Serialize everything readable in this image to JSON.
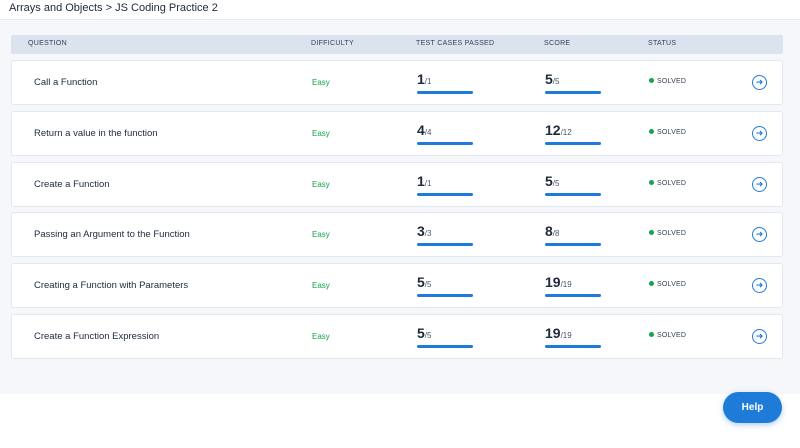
{
  "breadcrumb": {
    "parent": "Arrays and Objects",
    "separator": ">",
    "current": "JS Coding Practice 2"
  },
  "table": {
    "headers": {
      "question": "QUESTION",
      "difficulty": "DIFFICULTY",
      "tests": "TEST CASES PASSED",
      "score": "SCORE",
      "status": "STATUS"
    },
    "rows": [
      {
        "question": "Call a Function",
        "difficulty": "Easy",
        "tests_passed": "1",
        "tests_total": "/1",
        "tests_fraction": 1,
        "score": "5",
        "score_total": "/5",
        "score_fraction": 1,
        "status": "SOLVED"
      },
      {
        "question": "Return a value in the function",
        "difficulty": "Easy",
        "tests_passed": "4",
        "tests_total": "/4",
        "tests_fraction": 1,
        "score": "12",
        "score_total": "/12",
        "score_fraction": 1,
        "status": "SOLVED"
      },
      {
        "question": "Create a Function",
        "difficulty": "Easy",
        "tests_passed": "1",
        "tests_total": "/1",
        "tests_fraction": 1,
        "score": "5",
        "score_total": "/5",
        "score_fraction": 1,
        "status": "SOLVED"
      },
      {
        "question": "Passing an Argument to the Function",
        "difficulty": "Easy",
        "tests_passed": "3",
        "tests_total": "/3",
        "tests_fraction": 1,
        "score": "8",
        "score_total": "/8",
        "score_fraction": 1,
        "status": "SOLVED"
      },
      {
        "question": "Creating a Function with Parameters",
        "difficulty": "Easy",
        "tests_passed": "5",
        "tests_total": "/5",
        "tests_fraction": 1,
        "score": "19",
        "score_total": "/19",
        "score_fraction": 1,
        "status": "SOLVED"
      },
      {
        "question": "Create a Function Expression",
        "difficulty": "Easy",
        "tests_passed": "5",
        "tests_total": "/5",
        "tests_fraction": 1,
        "score": "19",
        "score_total": "/19",
        "score_fraction": 1,
        "status": "SOLVED"
      }
    ]
  },
  "icons": {
    "row_action": "arrow-circle-right-icon",
    "status": "status-dot-icon"
  },
  "colors": {
    "accent": "#1f7bd8",
    "easy": "#16a34a",
    "solved_dot": "#16a34a",
    "header_bg": "#dbe3ef"
  },
  "help_button": {
    "label": "Help"
  }
}
